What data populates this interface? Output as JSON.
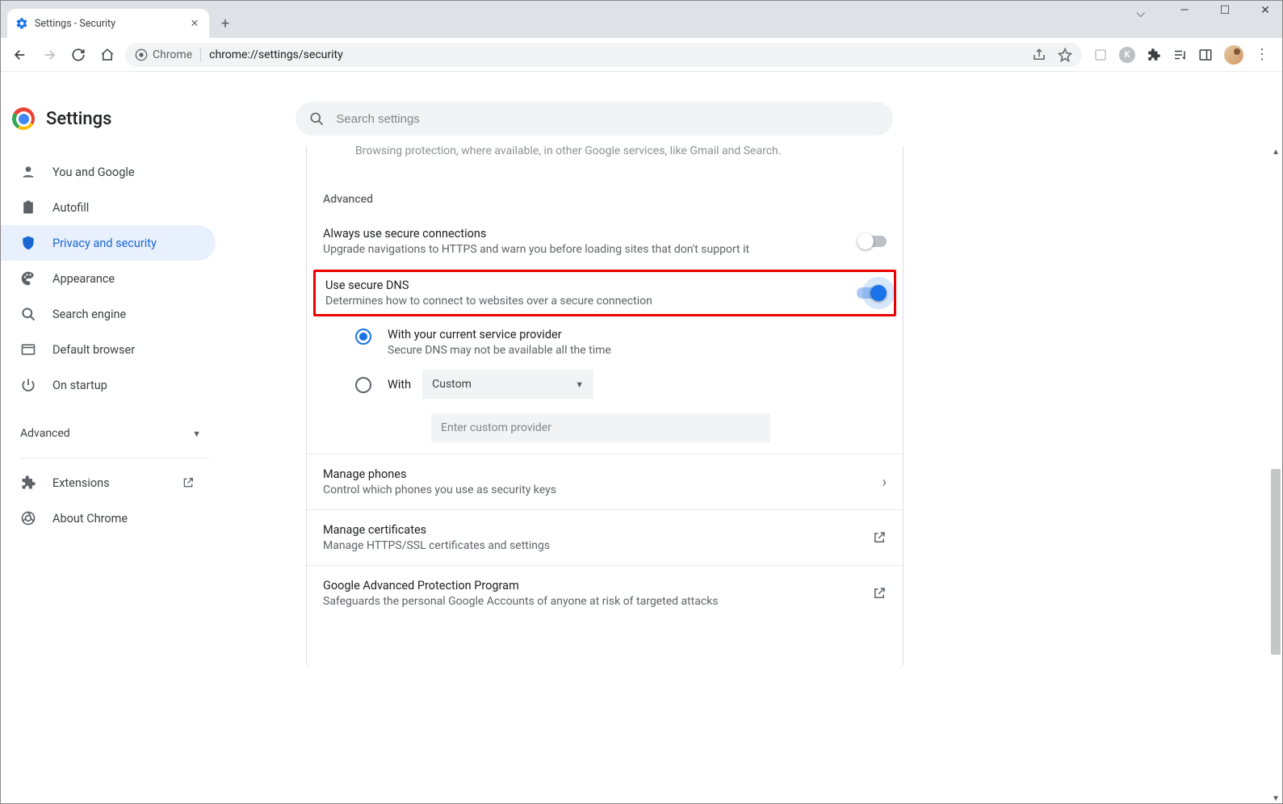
{
  "window": {
    "tab_title": "Settings - Security",
    "address_chip": "Chrome",
    "address_url": "chrome://settings/security"
  },
  "header": {
    "title": "Settings",
    "search_placeholder": "Search settings"
  },
  "sidebar": {
    "items": [
      {
        "label": "You and Google"
      },
      {
        "label": "Autofill"
      },
      {
        "label": "Privacy and security"
      },
      {
        "label": "Appearance"
      },
      {
        "label": "Search engine"
      },
      {
        "label": "Default browser"
      },
      {
        "label": "On startup"
      }
    ],
    "advanced": "Advanced",
    "extensions": "Extensions",
    "about": "About Chrome"
  },
  "main": {
    "faded_prev": "Browsing protection, where available, in other Google services, like Gmail and Search.",
    "advanced_heading": "Advanced",
    "secure_conn": {
      "title": "Always use secure connections",
      "sub": "Upgrade navigations to HTTPS and warn you before loading sites that don't support it",
      "on": false
    },
    "secure_dns": {
      "title": "Use secure DNS",
      "sub": "Determines how to connect to websites over a secure connection",
      "on": true,
      "option1_title": "With your current service provider",
      "option1_sub": "Secure DNS may not be available all the time",
      "option2_prefix": "With",
      "option2_select": "Custom",
      "option2_placeholder": "Enter custom provider"
    },
    "rows": [
      {
        "title": "Manage phones",
        "sub": "Control which phones you use as security keys",
        "glyph": "chevron"
      },
      {
        "title": "Manage certificates",
        "sub": "Manage HTTPS/SSL certificates and settings",
        "glyph": "open"
      },
      {
        "title": "Google Advanced Protection Program",
        "sub": "Safeguards the personal Google Accounts of anyone at risk of targeted attacks",
        "glyph": "open"
      }
    ]
  }
}
